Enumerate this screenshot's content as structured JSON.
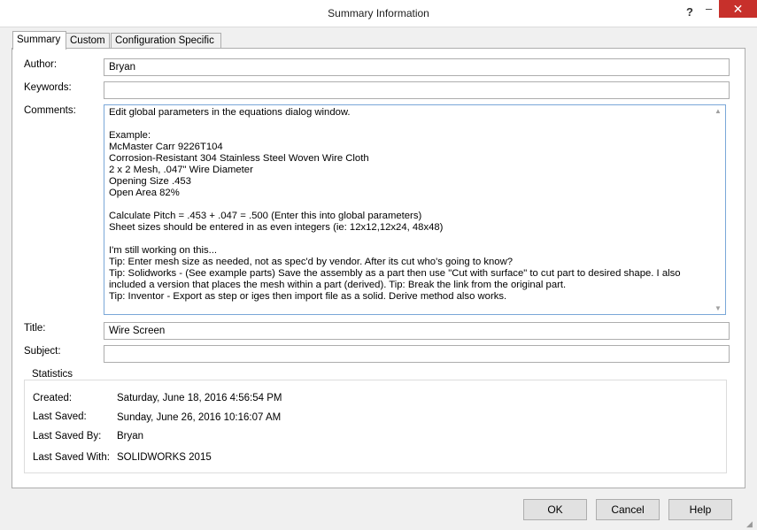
{
  "window": {
    "title": "Summary Information",
    "help_glyph": "?",
    "minimize_glyph": "▄",
    "close_glyph": "✕"
  },
  "tabs": [
    {
      "label": "Summary",
      "active": true
    },
    {
      "label": "Custom",
      "active": false
    },
    {
      "label": "Configuration Specific",
      "active": false
    }
  ],
  "summary": {
    "author_label": "Author:",
    "author_value": "Bryan",
    "keywords_label": "Keywords:",
    "keywords_value": "",
    "comments_label": "Comments:",
    "comments_value": "Edit global parameters in the equations dialog window.\n\nExample:\nMcMaster Carr 9226T104\nCorrosion-Resistant 304 Stainless Steel Woven Wire Cloth\n2 x 2 Mesh, .047\" Wire Diameter\nOpening Size .453\nOpen Area 82%\n\nCalculate Pitch = .453 + .047 = .500 (Enter this into global parameters)\nSheet sizes should be entered in as even integers (ie: 12x12,12x24, 48x48)\n\nI'm still working on this...\nTip: Enter mesh size as needed, not as spec'd by vendor. After its cut who's going to know?\nTip: Solidworks - (See example parts) Save the assembly as a part then use \"Cut with surface\" to cut part to desired shape. I also included a version that places the mesh within a part (derived). Tip: Break the link from the original part.\nTip: Inventor - Export as step or iges then import file as a solid. Derive method also works.",
    "title_label": "Title:",
    "title_value": "Wire Screen",
    "subject_label": "Subject:",
    "subject_value": ""
  },
  "statistics": {
    "heading": "Statistics",
    "created_label": "Created:",
    "created_value": "Saturday, June 18, 2016 4:56:54 PM",
    "last_saved_label": "Last Saved:",
    "last_saved_value": "Sunday, June 26, 2016 10:16:07 AM",
    "last_saved_by_label": "Last Saved By:",
    "last_saved_by_value": "Bryan",
    "last_saved_with_label": "Last Saved With:",
    "last_saved_with_value": "SOLIDWORKS 2015"
  },
  "buttons": {
    "ok": "OK",
    "cancel": "Cancel",
    "help": "Help"
  },
  "colors": {
    "close_button": "#c7302b",
    "focus_border": "#7aa7d8"
  }
}
